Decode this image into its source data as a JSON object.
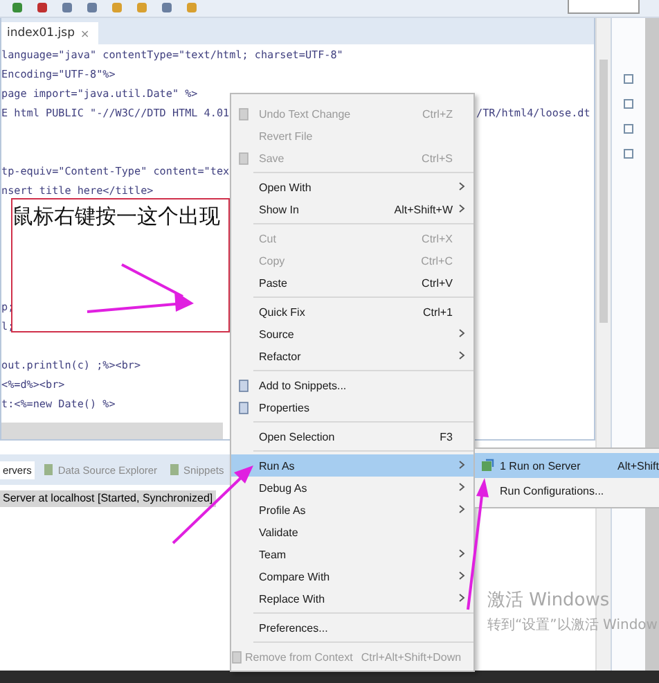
{
  "editor": {
    "tab": {
      "title": "index01.jsp",
      "close": "×"
    },
    "code_lines": [
      {
        "text": " language=\"java\" contentType=\"text/html; charset=UTF-8\""
      },
      {
        "text": "Encoding=\"UTF-8\"%>"
      },
      {
        "text": "page import=\"java.util.Date\" %>"
      },
      {
        "text": "E html PUBLIC \"-//W3C//DTD HTML 4.01",
        "tail": "/TR/html4/loose.dt"
      },
      {
        "text": "tp-equiv=\"Content-Type\" content=\"tex"
      },
      {
        "text": "nsert title here</title>"
      },
      {
        "text": "p;"
      },
      {
        "text": "l;"
      },
      {
        "text": "out.println(c) ;%><br>"
      },
      {
        "text": "<%=d%><br>"
      },
      {
        "text": "t:<%=new Date() %>"
      }
    ]
  },
  "servers_panel": {
    "tabs": [
      {
        "label": "ervers",
        "selected": true
      },
      {
        "label": "Data Source Explorer",
        "selected": false
      },
      {
        "label": "Snippets",
        "selected": false
      }
    ],
    "rows": [
      {
        "text": "Server at localhost  [Started, Synchronized]",
        "selected": true
      }
    ]
  },
  "context_menu": [
    {
      "kind": "item",
      "label": "Undo Text Change",
      "shortcut": "Ctrl+Z",
      "disabled": true,
      "has_icon": true
    },
    {
      "kind": "item",
      "label": "Revert File",
      "disabled": true
    },
    {
      "kind": "item",
      "label": "Save",
      "shortcut": "Ctrl+S",
      "disabled": true,
      "has_icon": true
    },
    {
      "kind": "separator"
    },
    {
      "kind": "item",
      "label": "Open With",
      "submenu": true
    },
    {
      "kind": "item",
      "label": "Show In",
      "shortcut": "Alt+Shift+W",
      "submenu": true
    },
    {
      "kind": "separator"
    },
    {
      "kind": "item",
      "label": "Cut",
      "shortcut": "Ctrl+X",
      "disabled": true
    },
    {
      "kind": "item",
      "label": "Copy",
      "shortcut": "Ctrl+C",
      "disabled": true
    },
    {
      "kind": "item",
      "label": "Paste",
      "shortcut": "Ctrl+V"
    },
    {
      "kind": "separator"
    },
    {
      "kind": "item",
      "label": "Quick Fix",
      "shortcut": "Ctrl+1"
    },
    {
      "kind": "item",
      "label": "Source",
      "submenu": true
    },
    {
      "kind": "item",
      "label": "Refactor",
      "submenu": true
    },
    {
      "kind": "separator"
    },
    {
      "kind": "item",
      "label": "Add to Snippets...",
      "has_icon": true
    },
    {
      "kind": "item",
      "label": "Properties",
      "has_icon": true
    },
    {
      "kind": "separator"
    },
    {
      "kind": "item",
      "label": "Open Selection",
      "shortcut": "F3"
    },
    {
      "kind": "separator"
    },
    {
      "kind": "item",
      "label": "Run As",
      "submenu": true,
      "selected": true
    },
    {
      "kind": "item",
      "label": "Debug As",
      "submenu": true
    },
    {
      "kind": "item",
      "label": "Profile As",
      "submenu": true
    },
    {
      "kind": "item",
      "label": "Validate"
    },
    {
      "kind": "item",
      "label": "Team",
      "submenu": true
    },
    {
      "kind": "item",
      "label": "Compare With",
      "submenu": true
    },
    {
      "kind": "item",
      "label": "Replace With",
      "submenu": true
    },
    {
      "kind": "separator"
    },
    {
      "kind": "item",
      "label": "Preferences..."
    },
    {
      "kind": "separator"
    },
    {
      "kind": "item",
      "label": "Remove from Context",
      "shortcut": "Ctrl+Alt+Shift+Down",
      "disabled": true,
      "has_icon": true
    }
  ],
  "submenu": [
    {
      "label": "1 Run on Server",
      "shortcut": "Alt+Shift",
      "selected": true,
      "has_icon": true
    },
    {
      "label": "Run Configurations...",
      "selected": false
    }
  ],
  "annotation": {
    "text": "鼠标右键按一这个出现"
  },
  "os_notice": {
    "title": "激活 Windows",
    "text": "转到“设置”以激活 Window"
  }
}
